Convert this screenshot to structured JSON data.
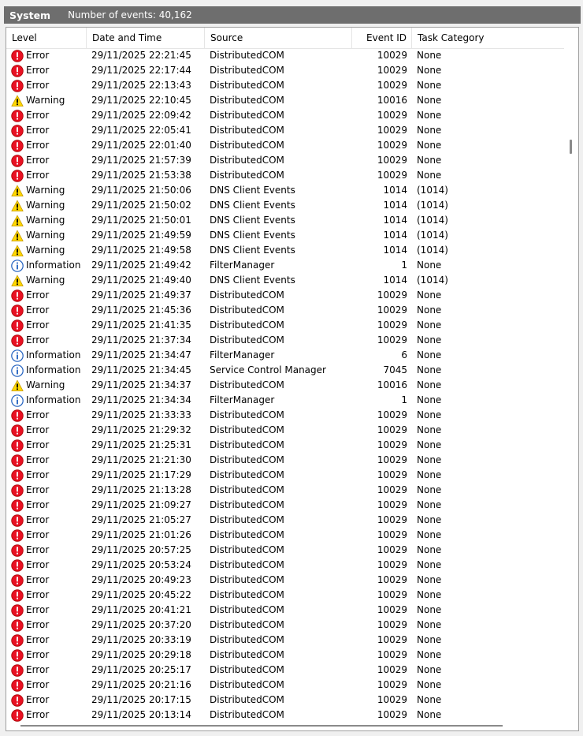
{
  "window": {
    "log_name": "System",
    "event_count": "Number of events: 40,162"
  },
  "columns": {
    "level": "Level",
    "date": "Date and Time",
    "source": "Source",
    "event_id": "Event ID",
    "task": "Task Category"
  },
  "icons": {
    "error": "error-icon",
    "warning": "warning-icon",
    "information": "information-icon"
  },
  "colors": {
    "error": "#e81123",
    "warning": "#ffd800",
    "information": "#1f5fbf",
    "titlebar": "#6e6e6e"
  },
  "events": [
    {
      "level": "Error",
      "date": "29/11/2025 22:21:45",
      "source": "DistributedCOM",
      "id": "10029",
      "task": "None"
    },
    {
      "level": "Error",
      "date": "29/11/2025 22:17:44",
      "source": "DistributedCOM",
      "id": "10029",
      "task": "None"
    },
    {
      "level": "Error",
      "date": "29/11/2025 22:13:43",
      "source": "DistributedCOM",
      "id": "10029",
      "task": "None"
    },
    {
      "level": "Warning",
      "date": "29/11/2025 22:10:45",
      "source": "DistributedCOM",
      "id": "10016",
      "task": "None"
    },
    {
      "level": "Error",
      "date": "29/11/2025 22:09:42",
      "source": "DistributedCOM",
      "id": "10029",
      "task": "None"
    },
    {
      "level": "Error",
      "date": "29/11/2025 22:05:41",
      "source": "DistributedCOM",
      "id": "10029",
      "task": "None"
    },
    {
      "level": "Error",
      "date": "29/11/2025 22:01:40",
      "source": "DistributedCOM",
      "id": "10029",
      "task": "None"
    },
    {
      "level": "Error",
      "date": "29/11/2025 21:57:39",
      "source": "DistributedCOM",
      "id": "10029",
      "task": "None"
    },
    {
      "level": "Error",
      "date": "29/11/2025 21:53:38",
      "source": "DistributedCOM",
      "id": "10029",
      "task": "None"
    },
    {
      "level": "Warning",
      "date": "29/11/2025 21:50:06",
      "source": "DNS Client Events",
      "id": "1014",
      "task": "(1014)"
    },
    {
      "level": "Warning",
      "date": "29/11/2025 21:50:02",
      "source": "DNS Client Events",
      "id": "1014",
      "task": "(1014)"
    },
    {
      "level": "Warning",
      "date": "29/11/2025 21:50:01",
      "source": "DNS Client Events",
      "id": "1014",
      "task": "(1014)"
    },
    {
      "level": "Warning",
      "date": "29/11/2025 21:49:59",
      "source": "DNS Client Events",
      "id": "1014",
      "task": "(1014)"
    },
    {
      "level": "Warning",
      "date": "29/11/2025 21:49:58",
      "source": "DNS Client Events",
      "id": "1014",
      "task": "(1014)"
    },
    {
      "level": "Information",
      "date": "29/11/2025 21:49:42",
      "source": "FilterManager",
      "id": "1",
      "task": "None"
    },
    {
      "level": "Warning",
      "date": "29/11/2025 21:49:40",
      "source": "DNS Client Events",
      "id": "1014",
      "task": "(1014)"
    },
    {
      "level": "Error",
      "date": "29/11/2025 21:49:37",
      "source": "DistributedCOM",
      "id": "10029",
      "task": "None"
    },
    {
      "level": "Error",
      "date": "29/11/2025 21:45:36",
      "source": "DistributedCOM",
      "id": "10029",
      "task": "None"
    },
    {
      "level": "Error",
      "date": "29/11/2025 21:41:35",
      "source": "DistributedCOM",
      "id": "10029",
      "task": "None"
    },
    {
      "level": "Error",
      "date": "29/11/2025 21:37:34",
      "source": "DistributedCOM",
      "id": "10029",
      "task": "None"
    },
    {
      "level": "Information",
      "date": "29/11/2025 21:34:47",
      "source": "FilterManager",
      "id": "6",
      "task": "None"
    },
    {
      "level": "Information",
      "date": "29/11/2025 21:34:45",
      "source": "Service Control Manager",
      "id": "7045",
      "task": "None"
    },
    {
      "level": "Warning",
      "date": "29/11/2025 21:34:37",
      "source": "DistributedCOM",
      "id": "10016",
      "task": "None"
    },
    {
      "level": "Information",
      "date": "29/11/2025 21:34:34",
      "source": "FilterManager",
      "id": "1",
      "task": "None"
    },
    {
      "level": "Error",
      "date": "29/11/2025 21:33:33",
      "source": "DistributedCOM",
      "id": "10029",
      "task": "None"
    },
    {
      "level": "Error",
      "date": "29/11/2025 21:29:32",
      "source": "DistributedCOM",
      "id": "10029",
      "task": "None"
    },
    {
      "level": "Error",
      "date": "29/11/2025 21:25:31",
      "source": "DistributedCOM",
      "id": "10029",
      "task": "None"
    },
    {
      "level": "Error",
      "date": "29/11/2025 21:21:30",
      "source": "DistributedCOM",
      "id": "10029",
      "task": "None"
    },
    {
      "level": "Error",
      "date": "29/11/2025 21:17:29",
      "source": "DistributedCOM",
      "id": "10029",
      "task": "None"
    },
    {
      "level": "Error",
      "date": "29/11/2025 21:13:28",
      "source": "DistributedCOM",
      "id": "10029",
      "task": "None"
    },
    {
      "level": "Error",
      "date": "29/11/2025 21:09:27",
      "source": "DistributedCOM",
      "id": "10029",
      "task": "None"
    },
    {
      "level": "Error",
      "date": "29/11/2025 21:05:27",
      "source": "DistributedCOM",
      "id": "10029",
      "task": "None"
    },
    {
      "level": "Error",
      "date": "29/11/2025 21:01:26",
      "source": "DistributedCOM",
      "id": "10029",
      "task": "None"
    },
    {
      "level": "Error",
      "date": "29/11/2025 20:57:25",
      "source": "DistributedCOM",
      "id": "10029",
      "task": "None"
    },
    {
      "level": "Error",
      "date": "29/11/2025 20:53:24",
      "source": "DistributedCOM",
      "id": "10029",
      "task": "None"
    },
    {
      "level": "Error",
      "date": "29/11/2025 20:49:23",
      "source": "DistributedCOM",
      "id": "10029",
      "task": "None"
    },
    {
      "level": "Error",
      "date": "29/11/2025 20:45:22",
      "source": "DistributedCOM",
      "id": "10029",
      "task": "None"
    },
    {
      "level": "Error",
      "date": "29/11/2025 20:41:21",
      "source": "DistributedCOM",
      "id": "10029",
      "task": "None"
    },
    {
      "level": "Error",
      "date": "29/11/2025 20:37:20",
      "source": "DistributedCOM",
      "id": "10029",
      "task": "None"
    },
    {
      "level": "Error",
      "date": "29/11/2025 20:33:19",
      "source": "DistributedCOM",
      "id": "10029",
      "task": "None"
    },
    {
      "level": "Error",
      "date": "29/11/2025 20:29:18",
      "source": "DistributedCOM",
      "id": "10029",
      "task": "None"
    },
    {
      "level": "Error",
      "date": "29/11/2025 20:25:17",
      "source": "DistributedCOM",
      "id": "10029",
      "task": "None"
    },
    {
      "level": "Error",
      "date": "29/11/2025 20:21:16",
      "source": "DistributedCOM",
      "id": "10029",
      "task": "None"
    },
    {
      "level": "Error",
      "date": "29/11/2025 20:17:15",
      "source": "DistributedCOM",
      "id": "10029",
      "task": "None"
    },
    {
      "level": "Error",
      "date": "29/11/2025 20:13:14",
      "source": "DistributedCOM",
      "id": "10029",
      "task": "None"
    }
  ]
}
